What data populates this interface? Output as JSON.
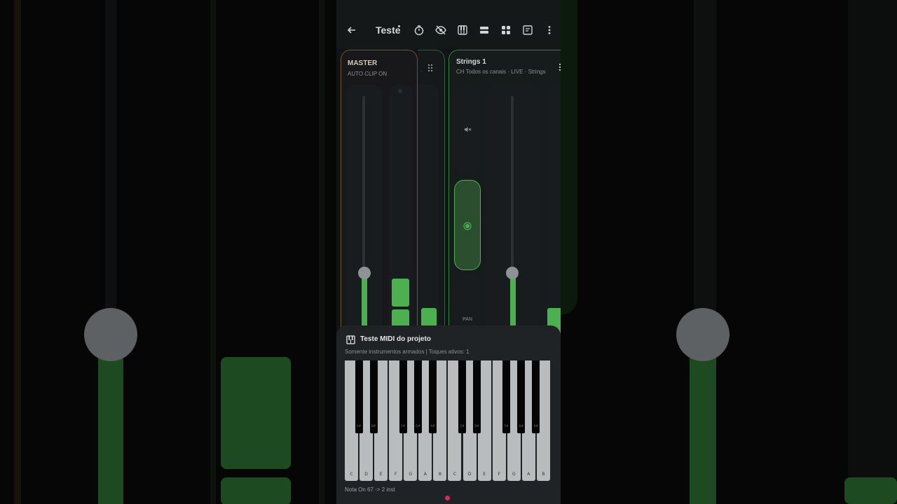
{
  "header": {
    "back_icon": "arrow-left-icon",
    "title": "Teste",
    "toolbar_icons": [
      "timer-icon",
      "eye-off-icon",
      "piano-icon",
      "rows-icon",
      "grid-icon",
      "note-icon",
      "more-vert-icon"
    ]
  },
  "channels": [
    {
      "name": "MASTER",
      "subtitle": "AUTO CLIP ON",
      "accent": "#8a6a2a"
    },
    {
      "name": "Strings 1",
      "subtitle": "CH Todos os canais · LIVE · Strings",
      "accent": "#3e8f48",
      "pan_label": "PAN"
    }
  ],
  "midi_test": {
    "title": "Teste MIDI do projeto",
    "subtitle": "Somente instrumentos armados | Toques ativos: 1",
    "white_keys": [
      "C",
      "D",
      "E",
      "F",
      "G",
      "A",
      "B",
      "C",
      "D",
      "E",
      "F",
      "G",
      "A",
      "B"
    ],
    "black_keys": [
      "C#",
      "D#",
      "F#",
      "G#",
      "A#",
      "C#",
      "D#",
      "F#",
      "G#",
      "A#"
    ],
    "status": "Nota On 67 -> 2 inst"
  },
  "colors": {
    "meter_green": "#4caf50",
    "active_key_marker": "#e0245e"
  }
}
